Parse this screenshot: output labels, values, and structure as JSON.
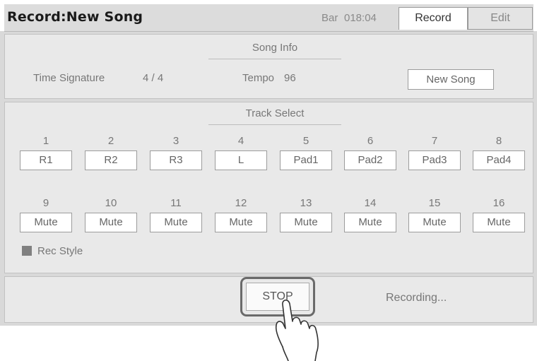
{
  "header": {
    "title": "Record:New Song",
    "bar_label": "Bar",
    "bar_value": "018:04",
    "tabs": [
      {
        "label": "Record",
        "active": true
      },
      {
        "label": "Edit",
        "active": false
      }
    ]
  },
  "song_info": {
    "section_title": "Song Info",
    "time_signature_label": "Time Signature",
    "time_signature_value": "4 / 4",
    "tempo_label": "Tempo",
    "tempo_value": "96",
    "new_song_label": "New Song"
  },
  "track_select": {
    "section_title": "Track Select",
    "tracks": [
      {
        "number": "1",
        "label": "R1"
      },
      {
        "number": "2",
        "label": "R2"
      },
      {
        "number": "3",
        "label": "R3"
      },
      {
        "number": "4",
        "label": "L"
      },
      {
        "number": "5",
        "label": "Pad1"
      },
      {
        "number": "6",
        "label": "Pad2"
      },
      {
        "number": "7",
        "label": "Pad3"
      },
      {
        "number": "8",
        "label": "Pad4"
      },
      {
        "number": "9",
        "label": "Mute"
      },
      {
        "number": "10",
        "label": "Mute"
      },
      {
        "number": "11",
        "label": "Mute"
      },
      {
        "number": "12",
        "label": "Mute"
      },
      {
        "number": "13",
        "label": "Mute"
      },
      {
        "number": "14",
        "label": "Mute"
      },
      {
        "number": "15",
        "label": "Mute"
      },
      {
        "number": "16",
        "label": "Mute"
      }
    ],
    "rec_style_label": "Rec Style"
  },
  "transport": {
    "stop_label": "STOP",
    "status": "Recording..."
  },
  "colors": {
    "panel_bg": "#e9e9e9",
    "title_bar_bg": "#dcdcdc",
    "button_bg": "#ffffff"
  }
}
